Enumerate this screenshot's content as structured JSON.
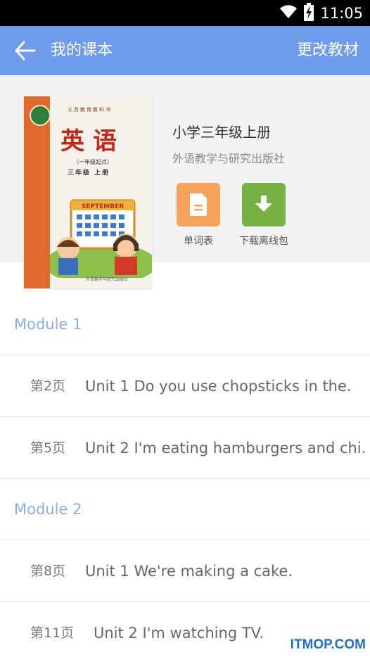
{
  "status_bar": {
    "time": "11:05",
    "icons": [
      "wifi-icon",
      "battery-charging-icon"
    ]
  },
  "app_bar": {
    "title": "我的课本",
    "action_label": "更改教材",
    "back_icon": "arrow-left-icon"
  },
  "book": {
    "name": "小学三年级上册",
    "publisher": "外语教学与研究出版社",
    "cover": {
      "series": "义务教育教科书",
      "title": "英语",
      "subtitle_1": "（一年级起点）",
      "subtitle_2": "三年级 上册",
      "calendar_text": "SEPTEMBER",
      "publisher": "外语教学与研究出版社"
    },
    "actions": [
      {
        "label": "单词表",
        "icon": "document-icon",
        "color": "#f7a35c"
      },
      {
        "label": "下载离线包",
        "icon": "download-icon",
        "color": "#78b244"
      }
    ]
  },
  "modules": [
    {
      "title": "Module 1",
      "units": [
        {
          "page": "第2页",
          "title": "Unit 1 Do you use chopsticks in the."
        },
        {
          "page": "第5页",
          "title": "Unit 2 I'm eating hamburgers and chi."
        }
      ]
    },
    {
      "title": "Module 2",
      "units": [
        {
          "page": "第8页",
          "title": "Unit 1 We're making a cake."
        },
        {
          "page": "第11页",
          "title": "Unit 2 I'm watching TV."
        }
      ]
    }
  ],
  "watermark": "ITMOP.COM",
  "colors": {
    "app_bar": "#6e9cea",
    "module_title": "#8aaee0",
    "watermark": "#1f6fc8"
  }
}
